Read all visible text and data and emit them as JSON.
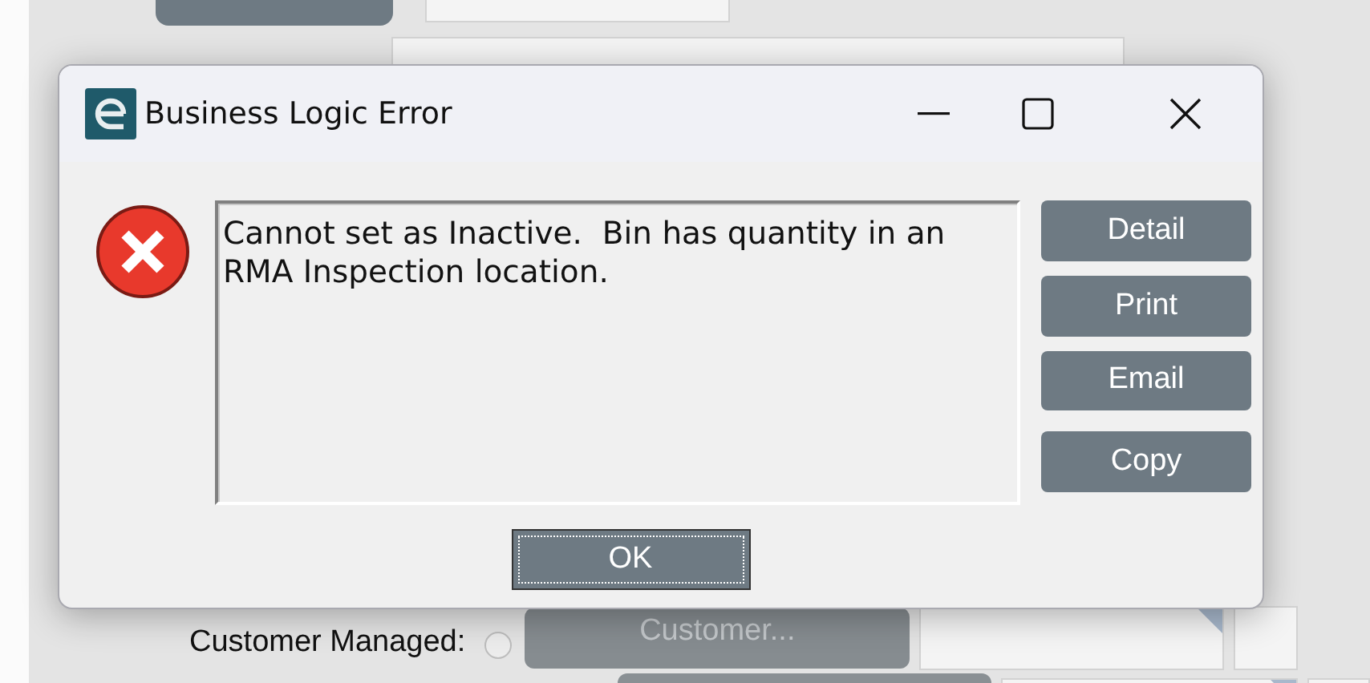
{
  "background_form": {
    "customer_managed": {
      "label": "Customer Managed:",
      "selected": false
    },
    "customer_button": {
      "label": "Customer...",
      "disabled": true
    }
  },
  "dialog": {
    "title": "Business Logic Error",
    "message": "Cannot set as Inactive.  Bin has quantity in an RMA Inspection location.",
    "side_buttons": [
      "Detail",
      "Print",
      "Email",
      "Copy"
    ],
    "ok_button": "OK"
  }
}
